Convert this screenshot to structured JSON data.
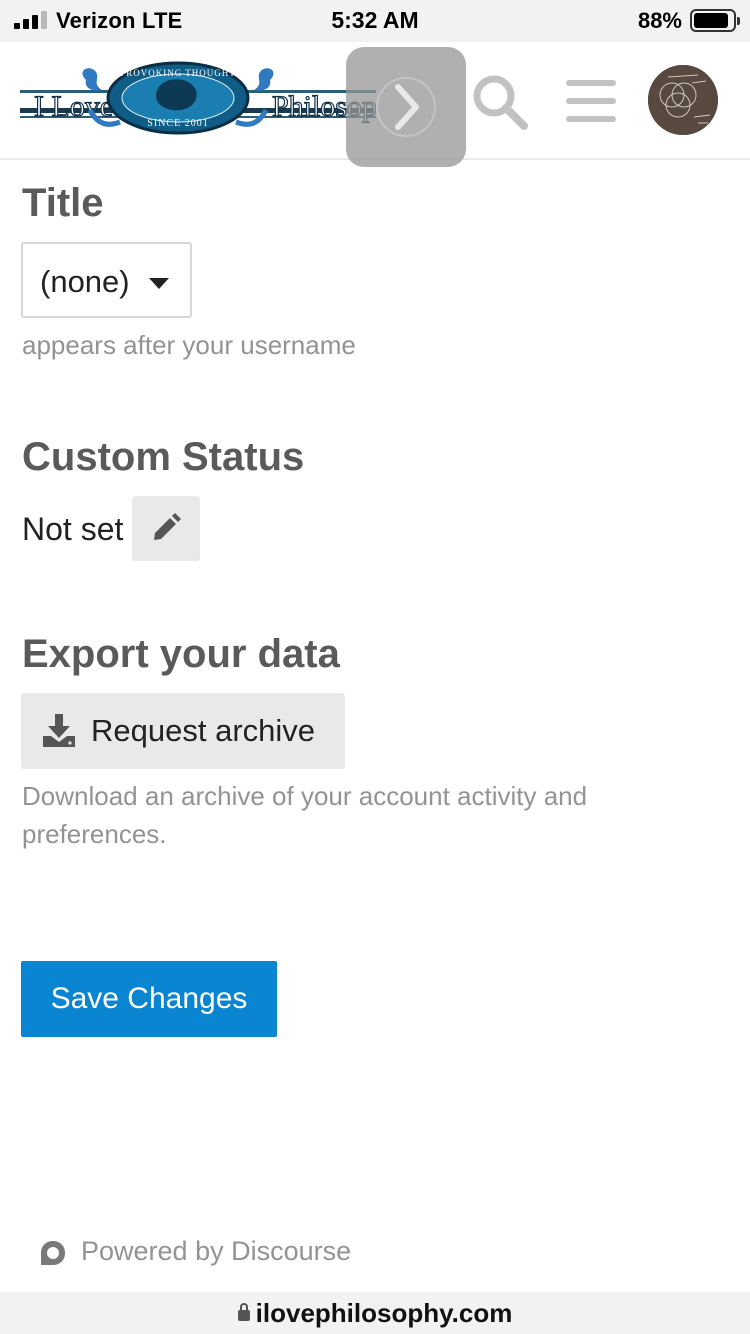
{
  "status_bar": {
    "carrier": "Verizon  LTE",
    "time": "5:32 AM",
    "battery_percent": "88%",
    "battery_level": 0.88,
    "signal_bars_filled": 3,
    "signal_bars_total": 4
  },
  "header": {
    "logo": {
      "left_text": "I Love",
      "right_text": "Philosophy",
      "ring_top": "PROVOKING THOUGHT",
      "ring_bottom": "SINCE 2001"
    },
    "icons": [
      "chevron-right-icon",
      "search-icon",
      "hamburger-menu-icon",
      "avatar"
    ]
  },
  "title_section": {
    "heading": "Title",
    "selected": "(none)",
    "help": "appears after your username"
  },
  "custom_status": {
    "heading": "Custom Status",
    "value": "Not set",
    "edit_icon": "pencil-icon"
  },
  "export": {
    "heading": "Export your data",
    "button_label": "Request archive",
    "button_icon": "download-icon",
    "help": "Download an archive of your account activity and preferences."
  },
  "save": {
    "label": "Save Changes"
  },
  "footer": {
    "powered_by": "Powered by Discourse",
    "icon": "discourse-icon"
  },
  "url_bar": {
    "domain": "ilovephilosophy.com",
    "icon": "lock-icon"
  },
  "colors": {
    "primary": "#0a85d2",
    "heading": "#5a5a5a",
    "muted": "#939393",
    "button_bg": "#e9e9e9"
  }
}
